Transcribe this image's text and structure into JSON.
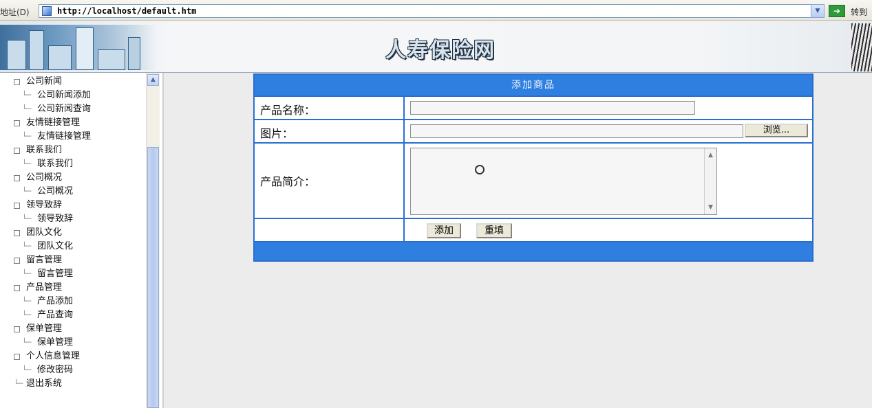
{
  "browser": {
    "address_label": "地址(D)",
    "url": "http://localhost/default.htm",
    "go_label": "转到",
    "dropdown_icon": "chevron-down-icon",
    "go_icon": "arrow-right-icon"
  },
  "banner": {
    "title": "人寿保险网"
  },
  "sidebar": {
    "items": [
      {
        "label": "公司新闻",
        "level": 0
      },
      {
        "label": "公司新闻添加",
        "level": 1
      },
      {
        "label": "公司新闻查询",
        "level": 1
      },
      {
        "label": "友情链接管理",
        "level": 0
      },
      {
        "label": "友情链接管理",
        "level": 1
      },
      {
        "label": "联系我们",
        "level": 0
      },
      {
        "label": "联系我们",
        "level": 1
      },
      {
        "label": "公司概况",
        "level": 0
      },
      {
        "label": "公司概况",
        "level": 1
      },
      {
        "label": "领导致辞",
        "level": 0
      },
      {
        "label": "领导致辞",
        "level": 1
      },
      {
        "label": "团队文化",
        "level": 0
      },
      {
        "label": "团队文化",
        "level": 1
      },
      {
        "label": "留言管理",
        "level": 0
      },
      {
        "label": "留言管理",
        "level": 1
      },
      {
        "label": "产品管理",
        "level": 0
      },
      {
        "label": "产品添加",
        "level": 1
      },
      {
        "label": "产品查询",
        "level": 1
      },
      {
        "label": "保单管理",
        "level": 0
      },
      {
        "label": "保单管理",
        "level": 1
      },
      {
        "label": "个人信息管理",
        "level": 0
      },
      {
        "label": "修改密码",
        "level": 1
      },
      {
        "label": "退出系统",
        "level": 2
      }
    ]
  },
  "form": {
    "title": "添加商品",
    "product_name_label": "产品名称：",
    "image_label": "图片：",
    "browse_label": "浏览...",
    "description_label": "产品简介：",
    "add_label": "添加",
    "reset_label": "重填",
    "product_name_value": "",
    "image_value": "",
    "description_value": ""
  },
  "colors": {
    "header_blue": "#2f7fe0",
    "border_blue": "#2a6fcf"
  }
}
